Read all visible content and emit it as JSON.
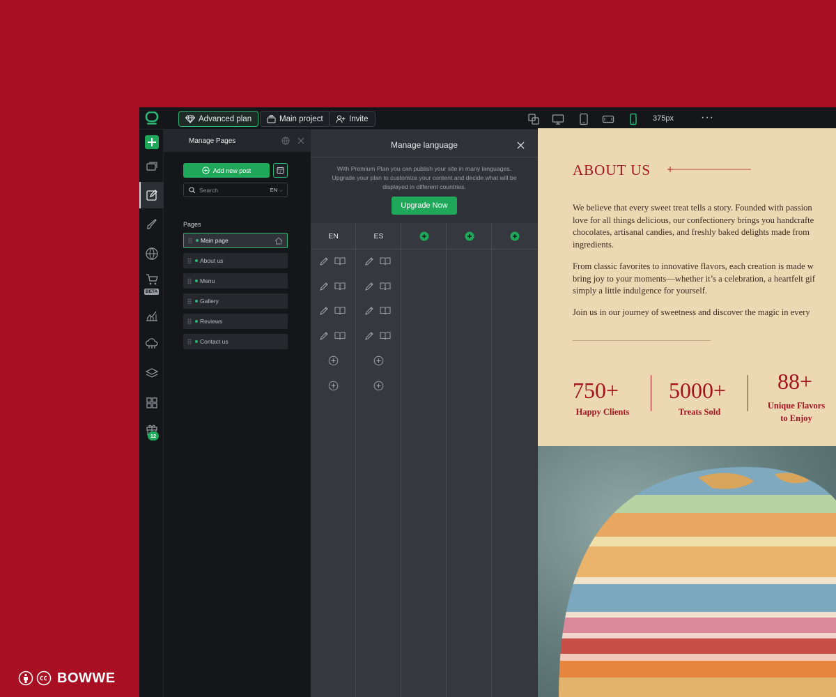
{
  "topbar": {
    "plan_label": "Advanced plan",
    "project_label": "Main project",
    "invite_label": "Invite",
    "zoom": "375px",
    "more": "···"
  },
  "rail": {
    "items": [
      "plus-icon",
      "windows-icon",
      "edit-icon",
      "brush-icon",
      "www-icon",
      "cart-icon",
      "chart-icon",
      "cloud-icon",
      "layers-icon",
      "apps-icon",
      "gift-icon"
    ],
    "beta": "BETA",
    "badge": "12"
  },
  "pages_panel": {
    "title": "Manage Pages",
    "add_post": "Add new post",
    "search_placeholder": "Search",
    "lang": "EN",
    "section_label": "Pages",
    "items": [
      {
        "label": "Main page",
        "selected": true
      },
      {
        "label": "About us"
      },
      {
        "label": "Menu"
      },
      {
        "label": "Gallery"
      },
      {
        "label": "Reviews"
      },
      {
        "label": "Contact us"
      }
    ]
  },
  "lang_panel": {
    "title": "Manage language",
    "info_line1": "With Premium Plan you can publish your site in many languages.",
    "info_line2": "Upgrade your plan to customize your content and decide what will be",
    "info_line3": "displayed in different countries.",
    "upgrade": "Upgrade Now",
    "columns": [
      "EN",
      "ES"
    ]
  },
  "preview": {
    "title": "ABOUT US",
    "p1": [
      "We believe that every sweet treat tells a story. Founded with passion",
      "love for all things delicious, our confectionery brings you handcrafte",
      "chocolates, artisanal candies, and freshly baked delights made from",
      "ingredients."
    ],
    "p2": [
      "From classic favorites to innovative flavors, each creation is made w",
      "bring joy to your moments—whether it’s a celebration, a heartfelt gif",
      "simply a little indulgence for yourself."
    ],
    "p3": "Join us in our journey of sweetness and discover the magic in every",
    "stats": [
      {
        "num": "750+",
        "label": "Happy Clients"
      },
      {
        "num": "5000+",
        "label": "Treats Sold"
      },
      {
        "num": "88+",
        "label1": "Unique Flavors",
        "label2": "to Enjoy"
      }
    ]
  },
  "brand": {
    "name": "BOWWE",
    "accent": "#1fa85a",
    "bg": "#a90f22",
    "heading": "#a3141f"
  }
}
